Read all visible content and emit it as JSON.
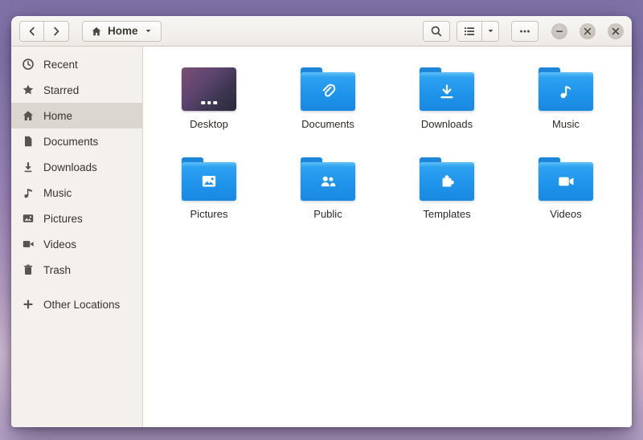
{
  "colors": {
    "folder_blue": "#1f94eb",
    "folder_tab_blue": "#1b86da",
    "sidebar_selected": "#dbd6d0",
    "titlebar_bg": "#f1eeea"
  },
  "titlebar": {
    "location_label": "Home"
  },
  "sidebar": {
    "items": [
      {
        "label": "Recent",
        "icon": "clock-icon"
      },
      {
        "label": "Starred",
        "icon": "star-icon"
      },
      {
        "label": "Home",
        "icon": "home-icon",
        "selected": true
      },
      {
        "label": "Documents",
        "icon": "document-icon"
      },
      {
        "label": "Downloads",
        "icon": "download-icon"
      },
      {
        "label": "Music",
        "icon": "music-note-icon"
      },
      {
        "label": "Pictures",
        "icon": "picture-icon"
      },
      {
        "label": "Videos",
        "icon": "video-icon"
      },
      {
        "label": "Trash",
        "icon": "trash-icon"
      }
    ],
    "footer_item": {
      "label": "Other Locations",
      "icon": "plus-icon"
    }
  },
  "files": {
    "items": [
      {
        "label": "Desktop",
        "kind": "desktop-preview"
      },
      {
        "label": "Documents",
        "emblem": "paperclip"
      },
      {
        "label": "Downloads",
        "emblem": "arrow-down"
      },
      {
        "label": "Music",
        "emblem": "music-note"
      },
      {
        "label": "Pictures",
        "emblem": "photo"
      },
      {
        "label": "Public",
        "emblem": "people"
      },
      {
        "label": "Templates",
        "emblem": "puzzle"
      },
      {
        "label": "Videos",
        "emblem": "camera"
      }
    ]
  }
}
